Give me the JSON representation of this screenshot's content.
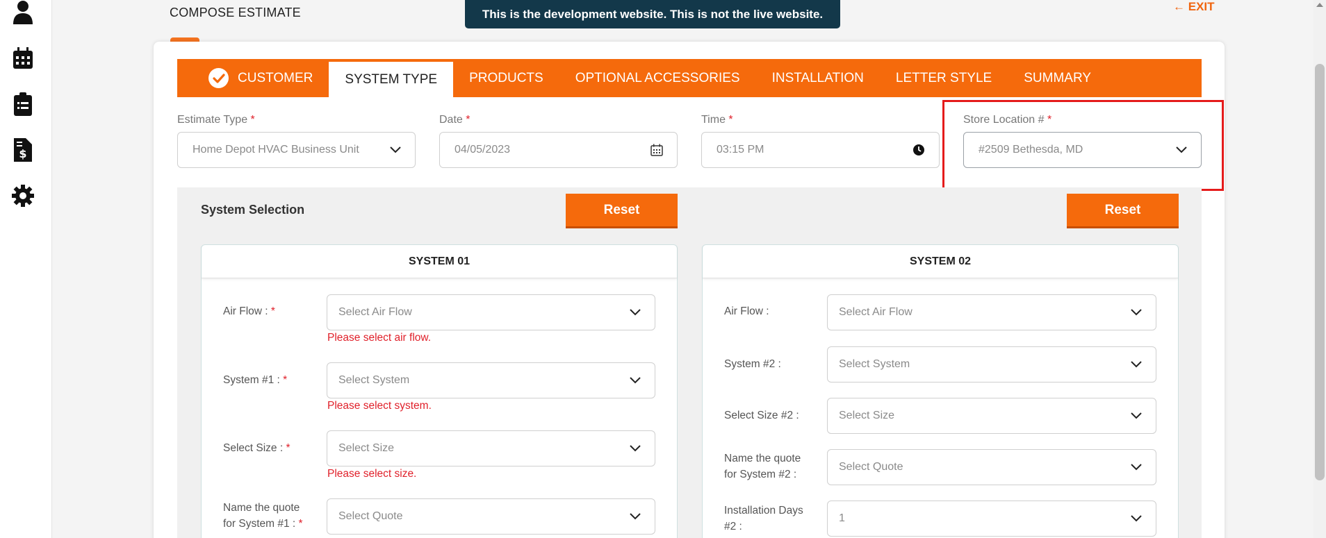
{
  "header": {
    "title": "COMPOSE ESTIMATE",
    "dev_banner": "This is the development website. This is not the live website.",
    "exit_label": "EXIT"
  },
  "sidebar": {
    "icons": [
      "user-icon",
      "calendar-icon",
      "clipboard-icon",
      "invoice-icon",
      "gear-icon"
    ]
  },
  "tabs": [
    {
      "label": "CUSTOMER",
      "completed": true
    },
    {
      "label": "SYSTEM TYPE",
      "active": true
    },
    {
      "label": "PRODUCTS"
    },
    {
      "label": "OPTIONAL ACCESSORIES"
    },
    {
      "label": "INSTALLATION"
    },
    {
      "label": "LETTER STYLE"
    },
    {
      "label": "SUMMARY"
    }
  ],
  "fields": {
    "estimate_type": {
      "label": "Estimate Type",
      "value": "Home Depot HVAC Business Unit"
    },
    "date": {
      "label": "Date",
      "value": "04/05/2023"
    },
    "time": {
      "label": "Time",
      "value": "03:15 PM"
    },
    "store_location": {
      "label": "Store Location #",
      "value": "#2509 Bethesda, MD"
    }
  },
  "system_selection": {
    "title": "System Selection",
    "reset_label": "Reset",
    "system1": {
      "title": "SYSTEM 01",
      "air_flow_label": "Air Flow :",
      "air_flow_placeholder": "Select Air Flow",
      "air_flow_error": "Please select air flow.",
      "system_label": "System #1 :",
      "system_placeholder": "Select System",
      "system_error": "Please select system.",
      "size_label": "Select Size :",
      "size_placeholder": "Select Size",
      "size_error": "Please select size.",
      "quote_label_1": "Name the quote",
      "quote_label_2": "for System #1 :",
      "quote_placeholder": "Select Quote"
    },
    "system2": {
      "title": "SYSTEM 02",
      "air_flow_label": "Air Flow :",
      "air_flow_placeholder": "Select Air Flow",
      "system_label": "System #2 :",
      "system_placeholder": "Select System",
      "size_label": "Select Size #2 :",
      "size_placeholder": "Select Size",
      "quote_label_1": "Name the quote",
      "quote_label_2": "for System #2 :",
      "quote_placeholder": "Select Quote",
      "install_label_1": "Installation Days",
      "install_label_2": "#2 :",
      "install_value": "1"
    }
  },
  "colors": {
    "accent": "#f56a0c",
    "banner": "#13384a",
    "error": "#e0202a"
  }
}
